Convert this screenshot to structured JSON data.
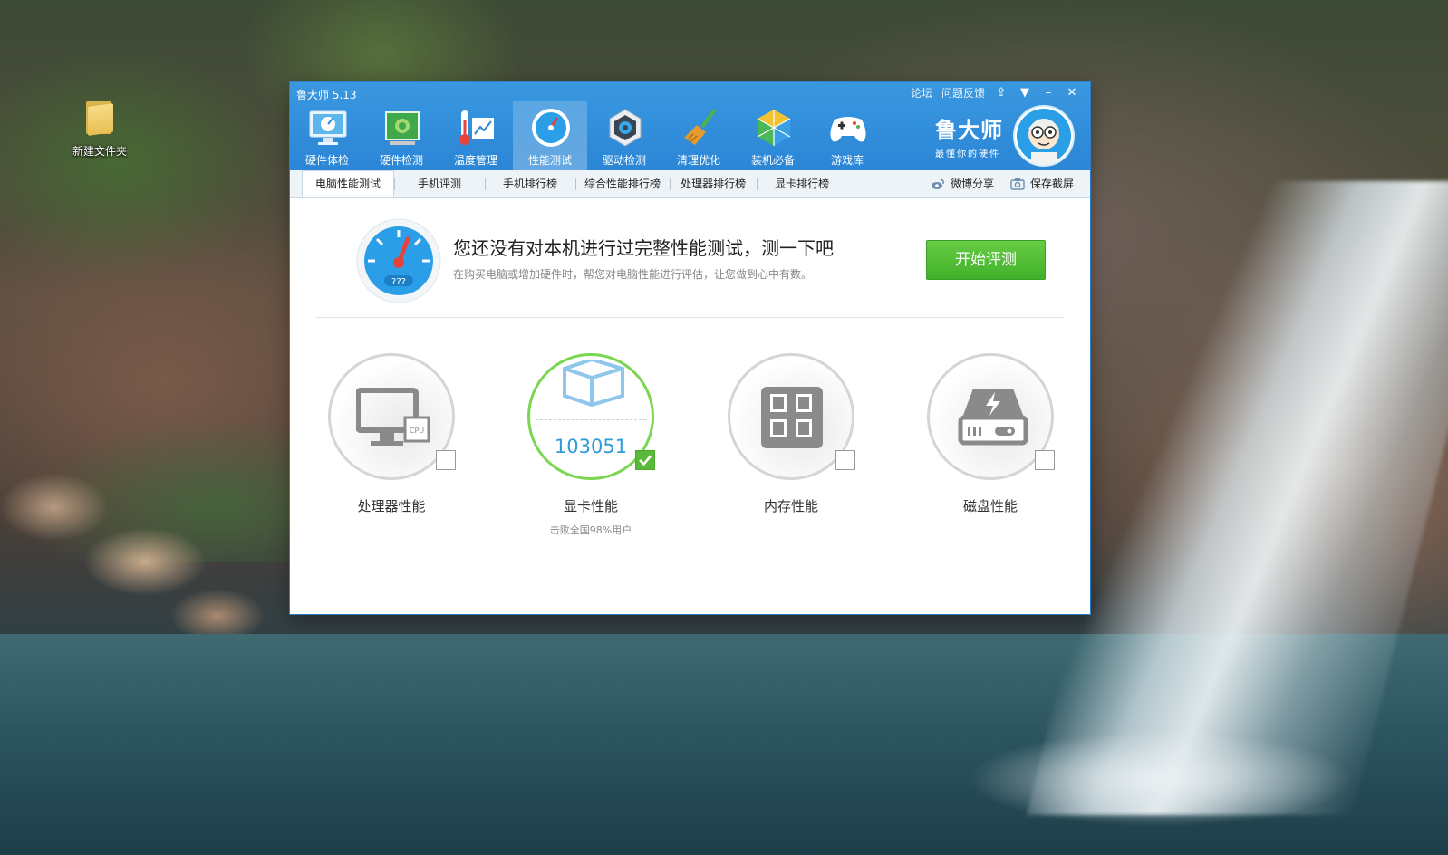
{
  "desktop": {
    "folder_label": "新建文件夹"
  },
  "window": {
    "title": "鲁大师 5.13",
    "top_links": [
      "论坛",
      "问题反馈"
    ],
    "controls": {
      "skin": "⇪",
      "menu": "▼",
      "minimize": "–",
      "close": "✕"
    }
  },
  "nav": [
    {
      "label": "硬件体检",
      "icon": "monitor-check-icon"
    },
    {
      "label": "硬件检测",
      "icon": "circuit-board-icon"
    },
    {
      "label": "温度管理",
      "icon": "thermometer-icon"
    },
    {
      "label": "性能测试",
      "icon": "speedometer-icon",
      "active": true
    },
    {
      "label": "驱动检测",
      "icon": "gear-icon"
    },
    {
      "label": "清理优化",
      "icon": "broom-icon"
    },
    {
      "label": "装机必备",
      "icon": "cube-icon"
    },
    {
      "label": "游戏库",
      "icon": "gamepad-icon"
    }
  ],
  "brand": {
    "name": "鲁大师",
    "slogan": "最懂你的硬件"
  },
  "tabs": [
    "电脑性能测试",
    "手机评测",
    "手机排行榜",
    "综合性能排行榜",
    "处理器排行榜",
    "显卡排行榜"
  ],
  "tab_tools": {
    "share": "微博分享",
    "screenshot": "保存截屏"
  },
  "banner": {
    "gauge_text": "???",
    "headline": "您还没有对本机进行过完整性能测试，测一下吧",
    "subline": "在购买电脑或增加硬件时，帮您对电脑性能进行评估，让您做到心中有数。",
    "start_button": "开始评测"
  },
  "cards": [
    {
      "label": "处理器性能",
      "checked": false,
      "score": null,
      "sub": ""
    },
    {
      "label": "显卡性能",
      "checked": true,
      "score": "103051",
      "sub": "击败全国98%用户"
    },
    {
      "label": "内存性能",
      "checked": false,
      "score": null,
      "sub": ""
    },
    {
      "label": "磁盘性能",
      "checked": false,
      "score": null,
      "sub": ""
    }
  ],
  "colors": {
    "titlebar": "#2b86d6",
    "accent_green": "#41b12a",
    "score_blue": "#2f9bd8"
  }
}
